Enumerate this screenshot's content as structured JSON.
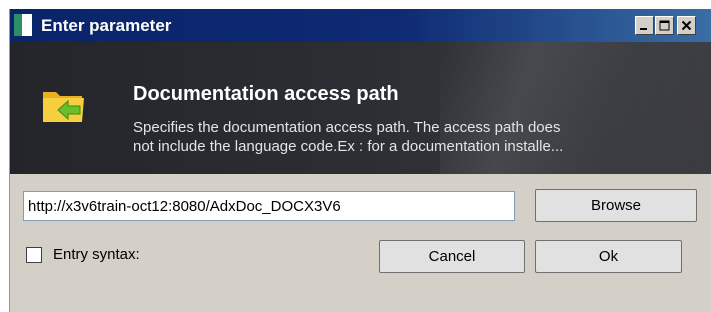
{
  "window": {
    "title": "Enter parameter"
  },
  "header": {
    "title": "Documentation access path",
    "description_line1": "Specifies the documentation access path. The access path does",
    "description_line2": "not include the language code.Ex : for a documentation installe..."
  },
  "form": {
    "path_value": "http://x3v6train-oct12:8080/AdxDoc_DOCX3V6",
    "browse_label": "Browse",
    "entry_syntax_label": "Entry syntax:",
    "entry_syntax_checked": false,
    "cancel_label": "Cancel",
    "ok_label": "Ok"
  },
  "icons": {
    "app": "app-icon",
    "minimize": "minimize-icon",
    "maximize": "maximize-icon",
    "close": "close-icon",
    "header": "folder-arrow-icon"
  },
  "colors": {
    "titlebar": "#0a246a",
    "header_bg": "#2c2e34",
    "dialog_bg": "#d4d0c8",
    "folder": "#f2c230",
    "arrow": "#6abf2a"
  }
}
